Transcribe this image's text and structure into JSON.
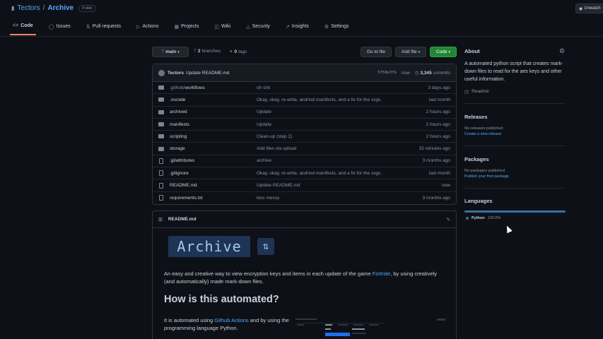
{
  "repo": {
    "owner": "Tectors",
    "separator": "/",
    "name": "Archive",
    "visibility": "Public"
  },
  "header": {
    "unwatch_label": "Unwatch"
  },
  "tabs": [
    {
      "label": "Code",
      "icon": "code-icon"
    },
    {
      "label": "Issues",
      "icon": "issue-icon"
    },
    {
      "label": "Pull requests",
      "icon": "pull-request-icon"
    },
    {
      "label": "Actions",
      "icon": "play-icon"
    },
    {
      "label": "Projects",
      "icon": "table-icon"
    },
    {
      "label": "Wiki",
      "icon": "book-icon"
    },
    {
      "label": "Security",
      "icon": "shield-icon"
    },
    {
      "label": "Insights",
      "icon": "graph-icon"
    },
    {
      "label": "Settings",
      "icon": "gear-icon"
    }
  ],
  "toolbar": {
    "branch": "main",
    "branches_count": "2",
    "branches_label": "branches",
    "tags_count": "0",
    "tags_label": "tags",
    "goto_file": "Go to file",
    "add_file": "Add file",
    "code": "Code"
  },
  "commit": {
    "author": "Tectors",
    "message": "Update README.md",
    "sha": "5f58e3fb",
    "time": "now",
    "count": "3,345",
    "count_label": "commits"
  },
  "files": [
    {
      "type": "folder",
      "name_prefix": ".github/",
      "name": "workflows",
      "message": "oh shit",
      "time": "3 days ago"
    },
    {
      "type": "folder",
      "name_prefix": "",
      "name": ".vscode",
      "message": "Okay, okay, re-write, andriod manifests, and a fix for the svgs.",
      "time": "last month"
    },
    {
      "type": "folder",
      "name_prefix": "",
      "name": "archived",
      "message": "Update",
      "time": "2 hours ago"
    },
    {
      "type": "folder",
      "name_prefix": "",
      "name": "manifests",
      "message": "Update",
      "time": "2 hours ago"
    },
    {
      "type": "folder",
      "name_prefix": "",
      "name": "scripting",
      "message": "Clean-up (step 2)",
      "time": "2 hours ago"
    },
    {
      "type": "folder",
      "name_prefix": "",
      "name": "storage",
      "message": "Add files via upload",
      "time": "15 minutes ago"
    },
    {
      "type": "file",
      "name_prefix": "",
      "name": ".gitattributes",
      "message": "archive",
      "time": "3 months ago"
    },
    {
      "type": "file",
      "name_prefix": "",
      "name": ".gitignore",
      "message": "Okay, okay, re-write, andriod manifests, and a fix for the svgs.",
      "time": "last month"
    },
    {
      "type": "file",
      "name_prefix": "",
      "name": "README.md",
      "message": "Update README.md",
      "time": "now"
    },
    {
      "type": "file",
      "name_prefix": "",
      "name": "requirements.txt",
      "message": "less messy",
      "time": "3 months ago"
    }
  ],
  "readme": {
    "filename": "README.md",
    "banner": "Archive",
    "intro_before": "An easy and creative way to view encryption keys and items in each update of the game ",
    "intro_link": "Fortnite",
    "intro_after": ", by using creatively (and automatically) made mark-down files.",
    "heading": "How is this automated?",
    "auto_before": "It is automated using ",
    "auto_link": "Github Actions",
    "auto_after": " and by using the programming language Python."
  },
  "about": {
    "heading": "About",
    "description": "A automated python script that creates mark-down files to read for the aes keys and other useful information.",
    "readme_label": "Readme"
  },
  "releases": {
    "heading": "Releases",
    "empty": "No releases published",
    "link": "Create a new release"
  },
  "packages": {
    "heading": "Packages",
    "empty": "No packages published",
    "link": "Publish your first package"
  },
  "languages": {
    "heading": "Languages",
    "items": [
      {
        "name": "Python",
        "percent": "100.0%",
        "color": "#3572A5"
      }
    ]
  },
  "colors": {
    "background": "#0d1117",
    "link": "#58a6ff",
    "accent_green": "#238636",
    "tab_underline": "#f78166"
  }
}
